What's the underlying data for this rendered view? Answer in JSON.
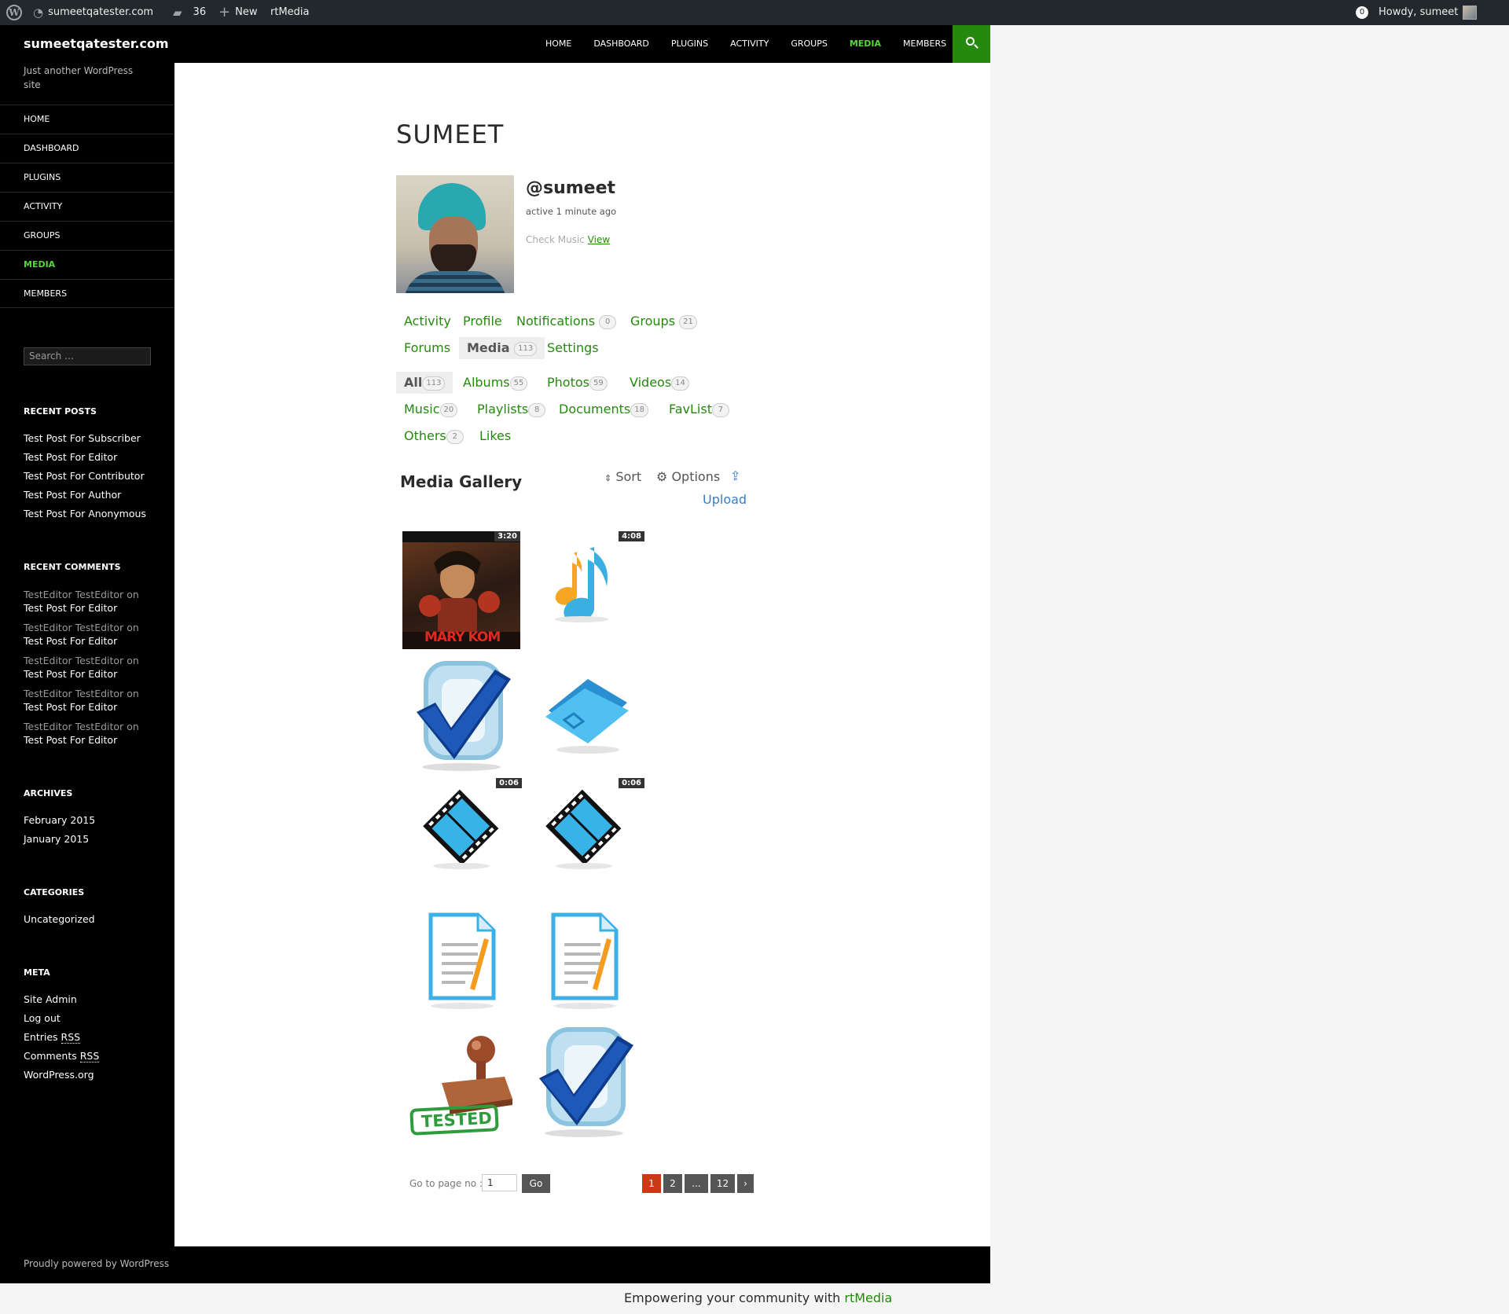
{
  "admin_bar": {
    "site": "sumeetqatester.com",
    "comments_count": "36",
    "new_label": "New",
    "rtmedia_label": "rtMedia",
    "notif_count": "0",
    "howdy": "Howdy, sumeet"
  },
  "site": {
    "title": "sumeetqatester.com",
    "description": "Just another WordPress site"
  },
  "nav": [
    "HOME",
    "DASHBOARD",
    "PLUGINS",
    "ACTIVITY",
    "GROUPS",
    "MEDIA",
    "MEMBERS"
  ],
  "nav_active": "MEDIA",
  "sidebar": {
    "search_placeholder": "Search …",
    "recent_posts_title": "RECENT POSTS",
    "recent_posts": [
      "Test Post For Subscriber",
      "Test Post For Editor",
      "Test Post For Contributor",
      "Test Post For Author",
      "Test Post For Anonymous"
    ],
    "recent_comments_title": "RECENT COMMENTS",
    "recent_comments": [
      {
        "author": "TestEditor TestEditor",
        "on": "on",
        "post": "Test Post For Editor"
      },
      {
        "author": "TestEditor TestEditor",
        "on": "on",
        "post": "Test Post For Editor"
      },
      {
        "author": "TestEditor TestEditor",
        "on": "on",
        "post": "Test Post For Editor"
      },
      {
        "author": "TestEditor TestEditor",
        "on": "on",
        "post": "Test Post For Editor"
      },
      {
        "author": "TestEditor TestEditor",
        "on": "on",
        "post": "Test Post For Editor"
      }
    ],
    "archives_title": "ARCHIVES",
    "archives": [
      "February 2015",
      "January 2015"
    ],
    "categories_title": "CATEGORIES",
    "categories": [
      "Uncategorized"
    ],
    "meta_title": "META",
    "meta": {
      "site_admin": "Site Admin",
      "log_out": "Log out",
      "entries": "Entries",
      "comments": "Comments",
      "rss": "RSS",
      "wordpress_org": "WordPress.org"
    }
  },
  "profile": {
    "title": "SUMEET",
    "username": "@sumeet",
    "activity": "active 1 minute ago",
    "latest_text": "Check Music",
    "latest_link": "View"
  },
  "member_tabs": [
    {
      "label": "Activity"
    },
    {
      "label": "Profile"
    },
    {
      "label": "Notifications",
      "count": "0"
    },
    {
      "label": "Groups",
      "count": "21"
    },
    {
      "label": "Forums"
    },
    {
      "label": "Media",
      "count": "113",
      "current": true
    },
    {
      "label": "Settings"
    }
  ],
  "media_tabs": [
    {
      "label": "All",
      "count": "113",
      "current": true
    },
    {
      "label": "Albums",
      "count": "55"
    },
    {
      "label": "Photos",
      "count": "59"
    },
    {
      "label": "Videos",
      "count": "14"
    },
    {
      "label": "Music",
      "count": "20"
    },
    {
      "label": "Playlists",
      "count": "8"
    },
    {
      "label": "Documents",
      "count": "18"
    },
    {
      "label": "FavList",
      "count": "7"
    },
    {
      "label": "Others",
      "count": "2"
    },
    {
      "label": "Likes"
    }
  ],
  "gallery": {
    "title": "Media Gallery",
    "sort": "Sort",
    "options": "Options",
    "upload": "Upload",
    "items": [
      {
        "kind": "photo-movie-poster",
        "duration": "3:20",
        "poster_text": "MARY KOM"
      },
      {
        "kind": "music-icon",
        "duration": "4:08"
      },
      {
        "kind": "checkmark-image"
      },
      {
        "kind": "folder-icon"
      },
      {
        "kind": "video-icon",
        "duration": "0:06"
      },
      {
        "kind": "video-icon",
        "duration": "0:06"
      },
      {
        "kind": "document-icon"
      },
      {
        "kind": "document-icon"
      },
      {
        "kind": "tested-stamp-image",
        "stamp_text": "TESTED"
      },
      {
        "kind": "checkmark-image"
      }
    ]
  },
  "pagination": {
    "go_label": "Go to page no :",
    "page_value": "1",
    "go_button": "Go",
    "pages": [
      "1",
      "2",
      "...",
      "12",
      "›"
    ],
    "current": "1"
  },
  "footer": {
    "powered": "Proudly powered by WordPress",
    "rtmedia_text": "Empowering your community with",
    "rtmedia_brand": "rtMedia"
  },
  "colors": {
    "accent": "#24890d",
    "active_nav": "#55d737",
    "link_blue": "#3b7cc6",
    "page_current": "#c93a16"
  }
}
